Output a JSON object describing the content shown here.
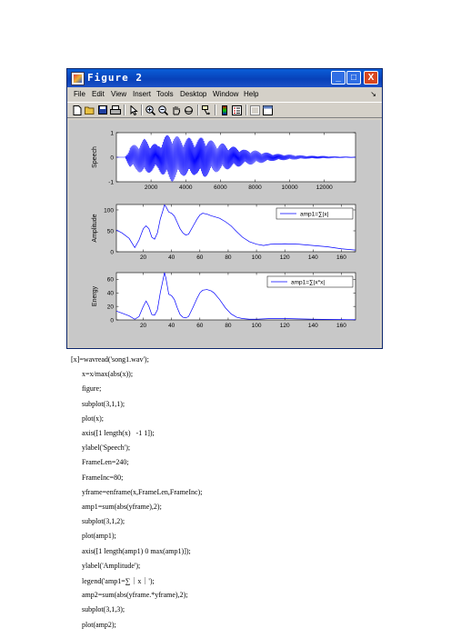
{
  "window": {
    "title": "Figure 2",
    "buttons": [
      "_",
      "□",
      "X"
    ]
  },
  "menubar": {
    "items": [
      "File",
      "Edit",
      "View",
      "Insert",
      "Tools",
      "Desktop",
      "Window",
      "Help"
    ],
    "overflow": "↘"
  },
  "toolbar": {
    "icons": [
      "new-figure-icon",
      "open-file-icon",
      "save-icon",
      "print-icon",
      "pointer-icon",
      "zoom-in-icon",
      "zoom-out-icon",
      "pan-hand-icon",
      "rotate-3d-icon",
      "data-cursor-icon",
      "colorbar-icon",
      "legend-icon",
      "hide-plot-tools-icon",
      "show-plot-tools-icon"
    ]
  },
  "chart_data": [
    {
      "type": "line",
      "title": "",
      "xlabel": "",
      "ylabel": "Speech",
      "xlim": [
        1,
        13800
      ],
      "ylim": [
        -1,
        1
      ],
      "xticks": [
        "2000",
        "4000",
        "6000",
        "8000",
        "10000",
        "12000"
      ],
      "yticks": [
        "1",
        "0",
        "-1"
      ],
      "series": [
        {
          "color": "#0000ff",
          "envelope_x": [
            1,
            500,
            800,
            1200,
            1600,
            2000,
            2400,
            2800,
            3200,
            3400,
            3800,
            4200,
            4600,
            5000,
            5400,
            5800,
            6200,
            6600,
            7000,
            7400,
            7800,
            8200,
            8600,
            9000,
            9600,
            10200,
            11000,
            12000,
            13000,
            13800
          ],
          "envelope_y": [
            0.0,
            0.0,
            0.45,
            0.55,
            0.75,
            0.6,
            0.5,
            0.85,
            1.0,
            0.9,
            0.75,
            0.8,
            0.7,
            0.85,
            0.7,
            0.6,
            0.55,
            0.45,
            0.4,
            0.3,
            0.3,
            0.25,
            0.2,
            0.15,
            0.12,
            0.1,
            0.06,
            0.05,
            0.03,
            0.02
          ]
        }
      ]
    },
    {
      "type": "line",
      "title": "",
      "xlabel": "",
      "ylabel": "Amplitude",
      "xlim": [
        1,
        170
      ],
      "ylim": [
        0,
        113
      ],
      "xticks": [
        "20",
        "40",
        "60",
        "80",
        "100",
        "120",
        "140",
        "160"
      ],
      "yticks": [
        "100",
        "50",
        "0"
      ],
      "legend": "amp1=∑|x|",
      "legend_position": "top-right",
      "series": [
        {
          "name": "amp1=∑|x|",
          "color": "#0000ff",
          "x": [
            1,
            5,
            10,
            14,
            17,
            20,
            22,
            24,
            26,
            28,
            30,
            32,
            34,
            35,
            36,
            38,
            40,
            42,
            44,
            46,
            48,
            50,
            52,
            55,
            58,
            60,
            62,
            65,
            68,
            70,
            74,
            78,
            82,
            86,
            90,
            95,
            100,
            105,
            110,
            120,
            130,
            140,
            150,
            160,
            170
          ],
          "y": [
            52,
            45,
            32,
            10,
            28,
            55,
            62,
            55,
            35,
            30,
            45,
            78,
            100,
            112,
            108,
            95,
            92,
            85,
            70,
            55,
            45,
            40,
            42,
            60,
            78,
            88,
            92,
            90,
            86,
            84,
            80,
            72,
            62,
            48,
            35,
            24,
            18,
            15,
            18,
            19,
            18,
            15,
            12,
            7,
            4
          ]
        }
      ]
    },
    {
      "type": "line",
      "title": "",
      "xlabel": "",
      "ylabel": "Energy",
      "xlim": [
        1,
        170
      ],
      "ylim": [
        0,
        70
      ],
      "xticks": [
        "20",
        "40",
        "60",
        "80",
        "100",
        "120",
        "140",
        "160"
      ],
      "yticks": [
        "60",
        "40",
        "20",
        "0"
      ],
      "legend": "amp1=∑|x*x|",
      "legend_position": "top-right",
      "series": [
        {
          "name": "amp1=∑|x*x|",
          "color": "#0000ff",
          "x": [
            1,
            5,
            10,
            14,
            17,
            20,
            22,
            24,
            26,
            28,
            30,
            32,
            34,
            35,
            36,
            38,
            40,
            42,
            44,
            46,
            48,
            50,
            52,
            55,
            58,
            60,
            62,
            65,
            68,
            70,
            74,
            78,
            82,
            86,
            90,
            95,
            100,
            110,
            120,
            140,
            160,
            170
          ],
          "y": [
            13,
            10,
            6,
            1,
            5,
            20,
            28,
            20,
            8,
            7,
            15,
            40,
            60,
            70,
            62,
            38,
            36,
            30,
            18,
            8,
            4,
            3,
            5,
            18,
            32,
            40,
            44,
            45,
            43,
            40,
            30,
            18,
            9,
            4,
            2,
            1,
            1,
            2,
            2,
            1,
            0.5,
            0.3
          ]
        }
      ]
    }
  ],
  "code_lines": [
    "[x]=wavread('song1.wav');",
    "x=x/max(abs(x));",
    "figure;",
    "subplot(3,1,1);",
    "plot(x);",
    "axis([1 length(x)   -1 1]);",
    "ylabel('Speech');",
    "FrameLen=240;",
    "FrameInc=80;",
    "yframe=enframe(x,FrameLen,FrameInc);",
    "amp1=sum(abs(yframe),2);",
    "subplot(3,1,2);",
    "plot(amp1);",
    "axis([1 length(amp1) 0 max(amp1)]);",
    "ylabel('Amplitude');",
    "legend('amp1=∑｜x｜');",
    "amp2=sum(abs(yframe.*yframe),2);",
    "subplot(3,1,3);",
    "plot(amp2);"
  ]
}
